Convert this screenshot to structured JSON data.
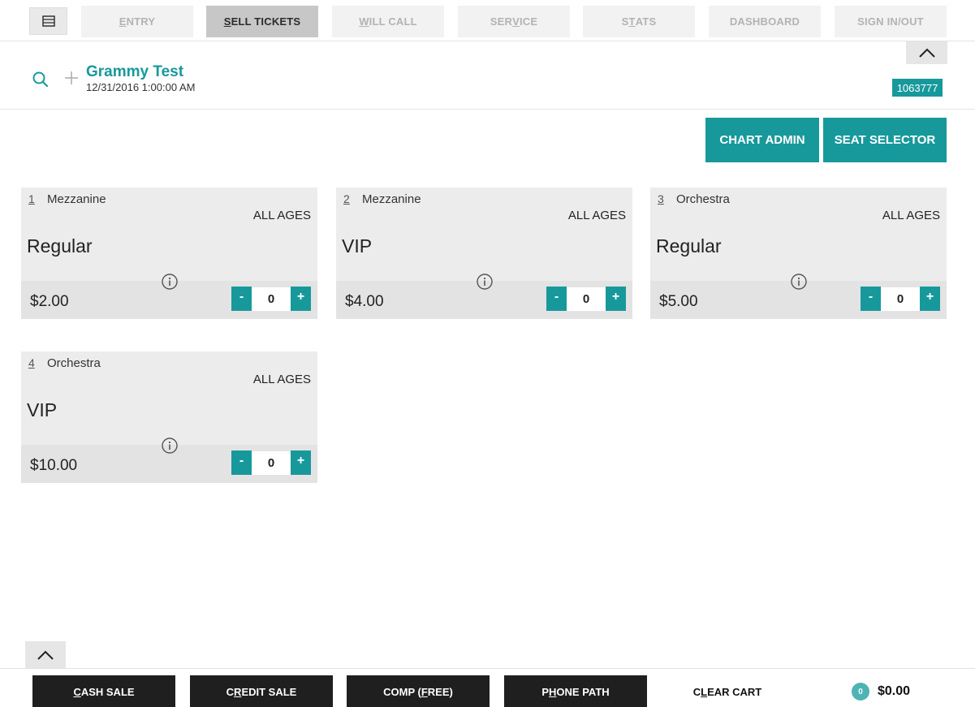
{
  "nav": {
    "tabs": [
      {
        "pre": "",
        "u": "E",
        "post": "NTRY"
      },
      {
        "pre": "",
        "u": "S",
        "post": "ELL TICKETS"
      },
      {
        "pre": "",
        "u": "W",
        "post": "ILL CALL"
      },
      {
        "pre": "SER",
        "u": "V",
        "post": "ICE"
      },
      {
        "pre": "S",
        "u": "T",
        "post": "ATS"
      },
      {
        "pre": "DASHBOARD",
        "u": "",
        "post": ""
      },
      {
        "pre": "SIGN IN/OUT",
        "u": "",
        "post": ""
      }
    ],
    "active_tab": "SELL TICKETS"
  },
  "event": {
    "title": "Grammy Test",
    "datetime": "12/31/2016 1:00:00 AM",
    "id": "1063777"
  },
  "actions": {
    "chart_admin": "CHART ADMIN",
    "seat_selector": "SEAT SELECTOR"
  },
  "tickets": [
    {
      "num": "1",
      "section": "Mezzanine",
      "ages": "ALL AGES",
      "type": "Regular",
      "price": "$2.00",
      "qty": "0",
      "minus": "-",
      "plus": "+"
    },
    {
      "num": "2",
      "section": "Mezzanine",
      "ages": "ALL AGES",
      "type": "VIP",
      "price": "$4.00",
      "qty": "0",
      "minus": "-",
      "plus": "+"
    },
    {
      "num": "3",
      "section": "Orchestra",
      "ages": "ALL AGES",
      "type": "Regular",
      "price": "$5.00",
      "qty": "0",
      "minus": "-",
      "plus": "+"
    },
    {
      "num": "4",
      "section": "Orchestra",
      "ages": "ALL AGES",
      "type": "VIP",
      "price": "$10.00",
      "qty": "0",
      "minus": "-",
      "plus": "+"
    }
  ],
  "bottom": {
    "buttons": [
      {
        "pre": "",
        "u": "C",
        "post": "ASH SALE"
      },
      {
        "pre": "C",
        "u": "R",
        "post": "EDIT SALE"
      },
      {
        "pre": "COMP (",
        "u": "F",
        "post": "REE)"
      },
      {
        "pre": "P",
        "u": "H",
        "post": "ONE PATH"
      }
    ],
    "clear_cart": {
      "pre": "C",
      "u": "L",
      "post": "EAR CART"
    },
    "cart_count": "0",
    "cart_total": "$0.00"
  },
  "colors": {
    "accent": "#17999c",
    "dark_button": "#1f1f1f",
    "card_bg": "#ececec"
  },
  "icons": [
    "menu-icon",
    "search-icon",
    "plus-icon",
    "chevron-up-icon",
    "info-icon"
  ]
}
